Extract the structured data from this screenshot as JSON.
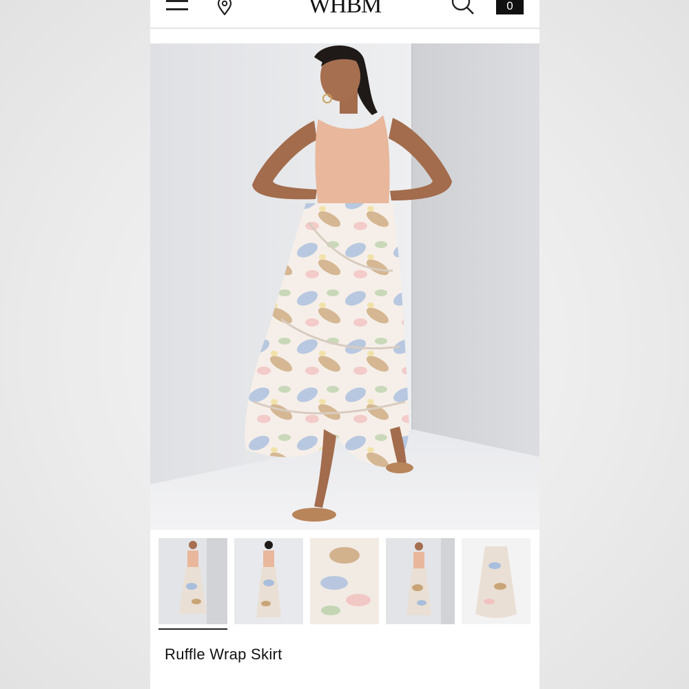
{
  "header": {
    "logo": "WHBM",
    "bag_count": "0",
    "icons": [
      "menu-icon",
      "location-pin-icon",
      "search-icon",
      "shopping-bag-icon"
    ]
  },
  "product": {
    "title": "Ruffle Wrap Skirt",
    "gallery": {
      "selected_index": 0,
      "thumbnails": [
        "front-view",
        "back-view",
        "fabric-detail",
        "front-view-alt",
        "flat-lay"
      ]
    }
  },
  "colors": {
    "top": "#e8b79c",
    "skirt_blue": "#9db4d6",
    "skirt_tan": "#c49a6c",
    "skirt_pink": "#f1c6c4",
    "background_wall": "#e3e4e7"
  }
}
